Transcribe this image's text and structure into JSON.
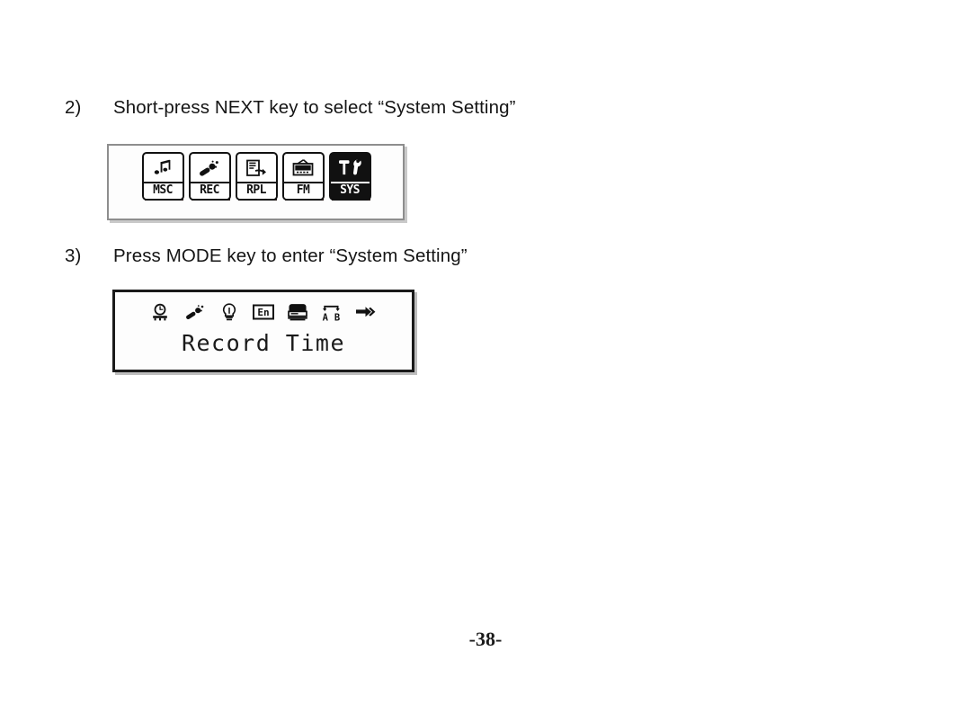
{
  "page": {
    "page_number": "-38-"
  },
  "steps": [
    {
      "number": "2)",
      "text": "Short-press NEXT key to select “System Setting”"
    },
    {
      "number": "3)",
      "text": "Press MODE key to enter “System Setting”"
    }
  ],
  "main_menu_screen": {
    "name": "main-menu-lcd",
    "selected": "SYS",
    "tiles": [
      {
        "label": "MSC",
        "icon": "music-note-icon",
        "selected": false
      },
      {
        "label": "REC",
        "icon": "microphone-icon",
        "selected": false
      },
      {
        "label": "RPL",
        "icon": "playback-page-icon",
        "selected": false
      },
      {
        "label": "FM",
        "icon": "radio-icon",
        "selected": false
      },
      {
        "label": "SYS",
        "icon": "tools-icon",
        "selected": true
      }
    ]
  },
  "system_menu_screen": {
    "name": "system-setting-lcd",
    "caption": "Record Time",
    "selected": "record-time",
    "icons": [
      {
        "name": "clock-icon",
        "title": "Record Time"
      },
      {
        "name": "microphone-icon",
        "title": "Record Type"
      },
      {
        "name": "backlight-bulb-icon",
        "title": "Backlight"
      },
      {
        "name": "language-en-icon",
        "title": "Language"
      },
      {
        "name": "display-contrast-icon",
        "title": "Contrast"
      },
      {
        "name": "replay-ab-icon",
        "title": "Replay"
      },
      {
        "name": "exit-arrow-icon",
        "title": "Exit"
      }
    ]
  },
  "colors": {
    "text": "#151515",
    "lcd_frame_gray": "#8e8e8e",
    "lcd_frame_black": "#1a1a1a",
    "lcd_background": "#fdfdfd",
    "icon_ink": "#111111"
  }
}
